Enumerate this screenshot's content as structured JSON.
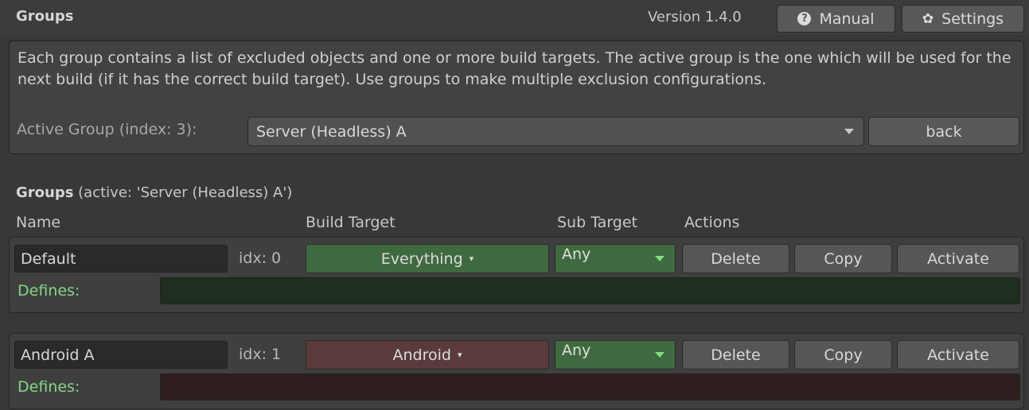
{
  "header": {
    "title": "Groups",
    "version": "Version 1.4.0",
    "manual_label": "Manual",
    "settings_label": "Settings"
  },
  "info": {
    "description": "Each group contains a list of excluded objects and one or more build targets. The active group is the one which will be used for the next build (if it has the correct build target). Use groups to make multiple exclusion configurations.",
    "active_label": "Active Group (index: 3):",
    "active_value": "Server (Headless) A",
    "back_label": "back"
  },
  "groups_list": {
    "title_bold": "Groups",
    "title_rest": " (active: 'Server (Headless) A')",
    "columns": {
      "name": "Name",
      "build_target": "Build Target",
      "sub_target": "Sub Target",
      "actions": "Actions"
    }
  },
  "groups": [
    {
      "name": "Default",
      "idx": "idx: 0",
      "build_target": "Everything",
      "sub_target": "Any",
      "delete_label": "Delete",
      "copy_label": "Copy",
      "activate_label": "Activate",
      "defines_label": "Defines:",
      "defines_value": ""
    },
    {
      "name": "Android A",
      "idx": "idx: 1",
      "build_target": "Android",
      "sub_target": "Any",
      "delete_label": "Delete",
      "copy_label": "Copy",
      "activate_label": "Activate",
      "defines_label": "Defines:",
      "defines_value": ""
    }
  ],
  "colors": {
    "background": "#383838",
    "target_green": "#3f6a3f",
    "target_red": "#5a3b3b",
    "defines_label": "#86d686"
  },
  "icons": {
    "manual": "help-circle-icon",
    "settings": "gear-icon",
    "dropdown": "chevron-down-icon"
  }
}
